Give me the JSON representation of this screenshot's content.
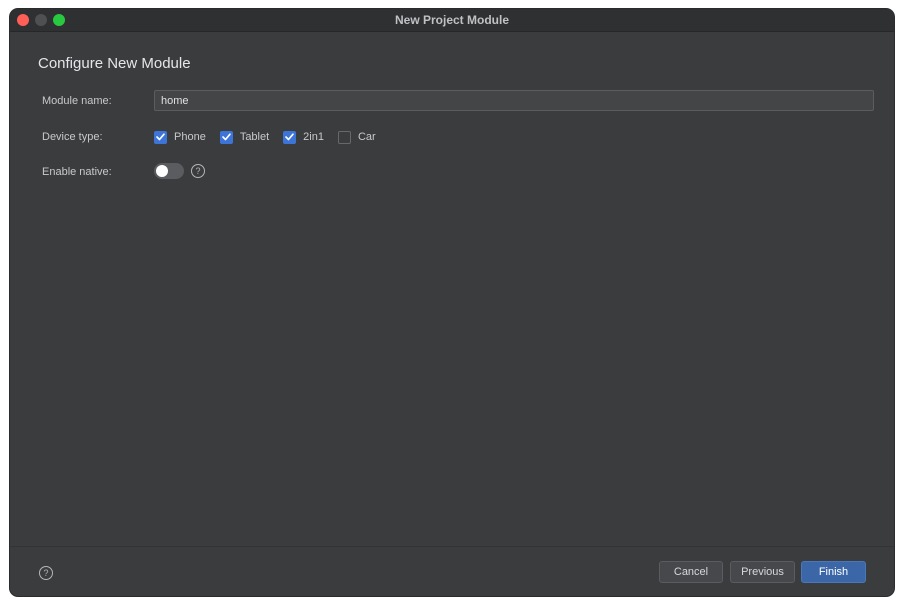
{
  "window": {
    "title": "New Project Module"
  },
  "page": {
    "heading": "Configure New Module"
  },
  "form": {
    "module_name": {
      "label": "Module name:",
      "value": "home"
    },
    "device_type": {
      "label": "Device type:",
      "options": [
        {
          "label": "Phone",
          "checked": true
        },
        {
          "label": "Tablet",
          "checked": true
        },
        {
          "label": "2in1",
          "checked": true
        },
        {
          "label": "Car",
          "checked": false
        }
      ]
    },
    "enable_native": {
      "label": "Enable native:",
      "enabled": false
    }
  },
  "footer": {
    "cancel_label": "Cancel",
    "previous_label": "Previous",
    "finish_label": "Finish"
  },
  "icons": {
    "help": "question-circle-icon",
    "check": "checkmark-icon"
  },
  "colors": {
    "accent": "#3d74d8",
    "primary_button": "#3b66a8",
    "background": "#3b3c3e"
  }
}
